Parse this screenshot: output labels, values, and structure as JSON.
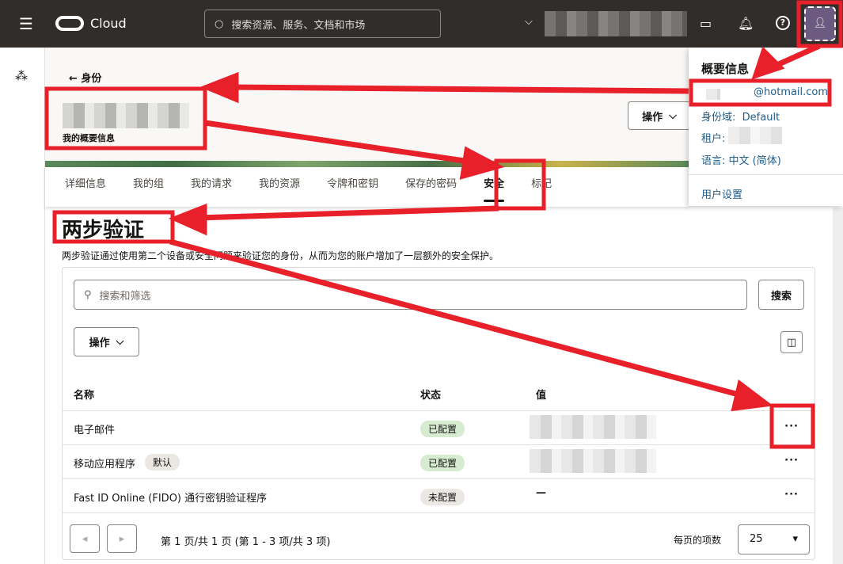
{
  "topbar": {
    "brand": "Cloud",
    "search_placeholder": "搜索资源、服务、文档和市场"
  },
  "header": {
    "back_label": "身份",
    "subtitle": "我的概要信息",
    "actions_label": "操作"
  },
  "tabs": [
    {
      "label": "详细信息"
    },
    {
      "label": "我的组"
    },
    {
      "label": "我的请求"
    },
    {
      "label": "我的资源"
    },
    {
      "label": "令牌和密钥"
    },
    {
      "label": "保存的密码"
    },
    {
      "label": "安全",
      "active": true
    },
    {
      "label": "标记"
    }
  ],
  "section": {
    "title": "两步验证",
    "description": "两步验证通过使用第二个设备或安全问题来验证您的身份，从而为您的账户增加了一层额外的安全保护。"
  },
  "toolbar": {
    "search_placeholder": "搜索和筛选",
    "search_label": "搜索",
    "actions_label": "操作"
  },
  "table": {
    "columns": [
      "名称",
      "状态",
      "值"
    ],
    "rows": [
      {
        "name": "电子邮件",
        "status": "已配置",
        "tag": ""
      },
      {
        "name": "移动应用程序",
        "status": "已配置",
        "tag": "默认"
      },
      {
        "name": "Fast ID Online (FIDO) 通行密钥验证程序",
        "status": "未配置",
        "tag": "",
        "value": "—"
      }
    ]
  },
  "pagination": {
    "summary": "第 1 页/共 1 页 (第 1 - 3 项/共 3 项)",
    "per_page_label": "每页的项数",
    "per_page": "25"
  },
  "profile_menu": {
    "title": "概要信息",
    "email": "@hotmail.com",
    "domain_label": "身份域:",
    "domain": "Default",
    "tenant_label": "租户:",
    "language_label": "语言:",
    "language": "中文 (简体)",
    "user_settings": "用户设置"
  },
  "colors": {
    "topbar": "#312d2a",
    "annotation": "#e8202a",
    "configured": "#d6ebcf"
  }
}
